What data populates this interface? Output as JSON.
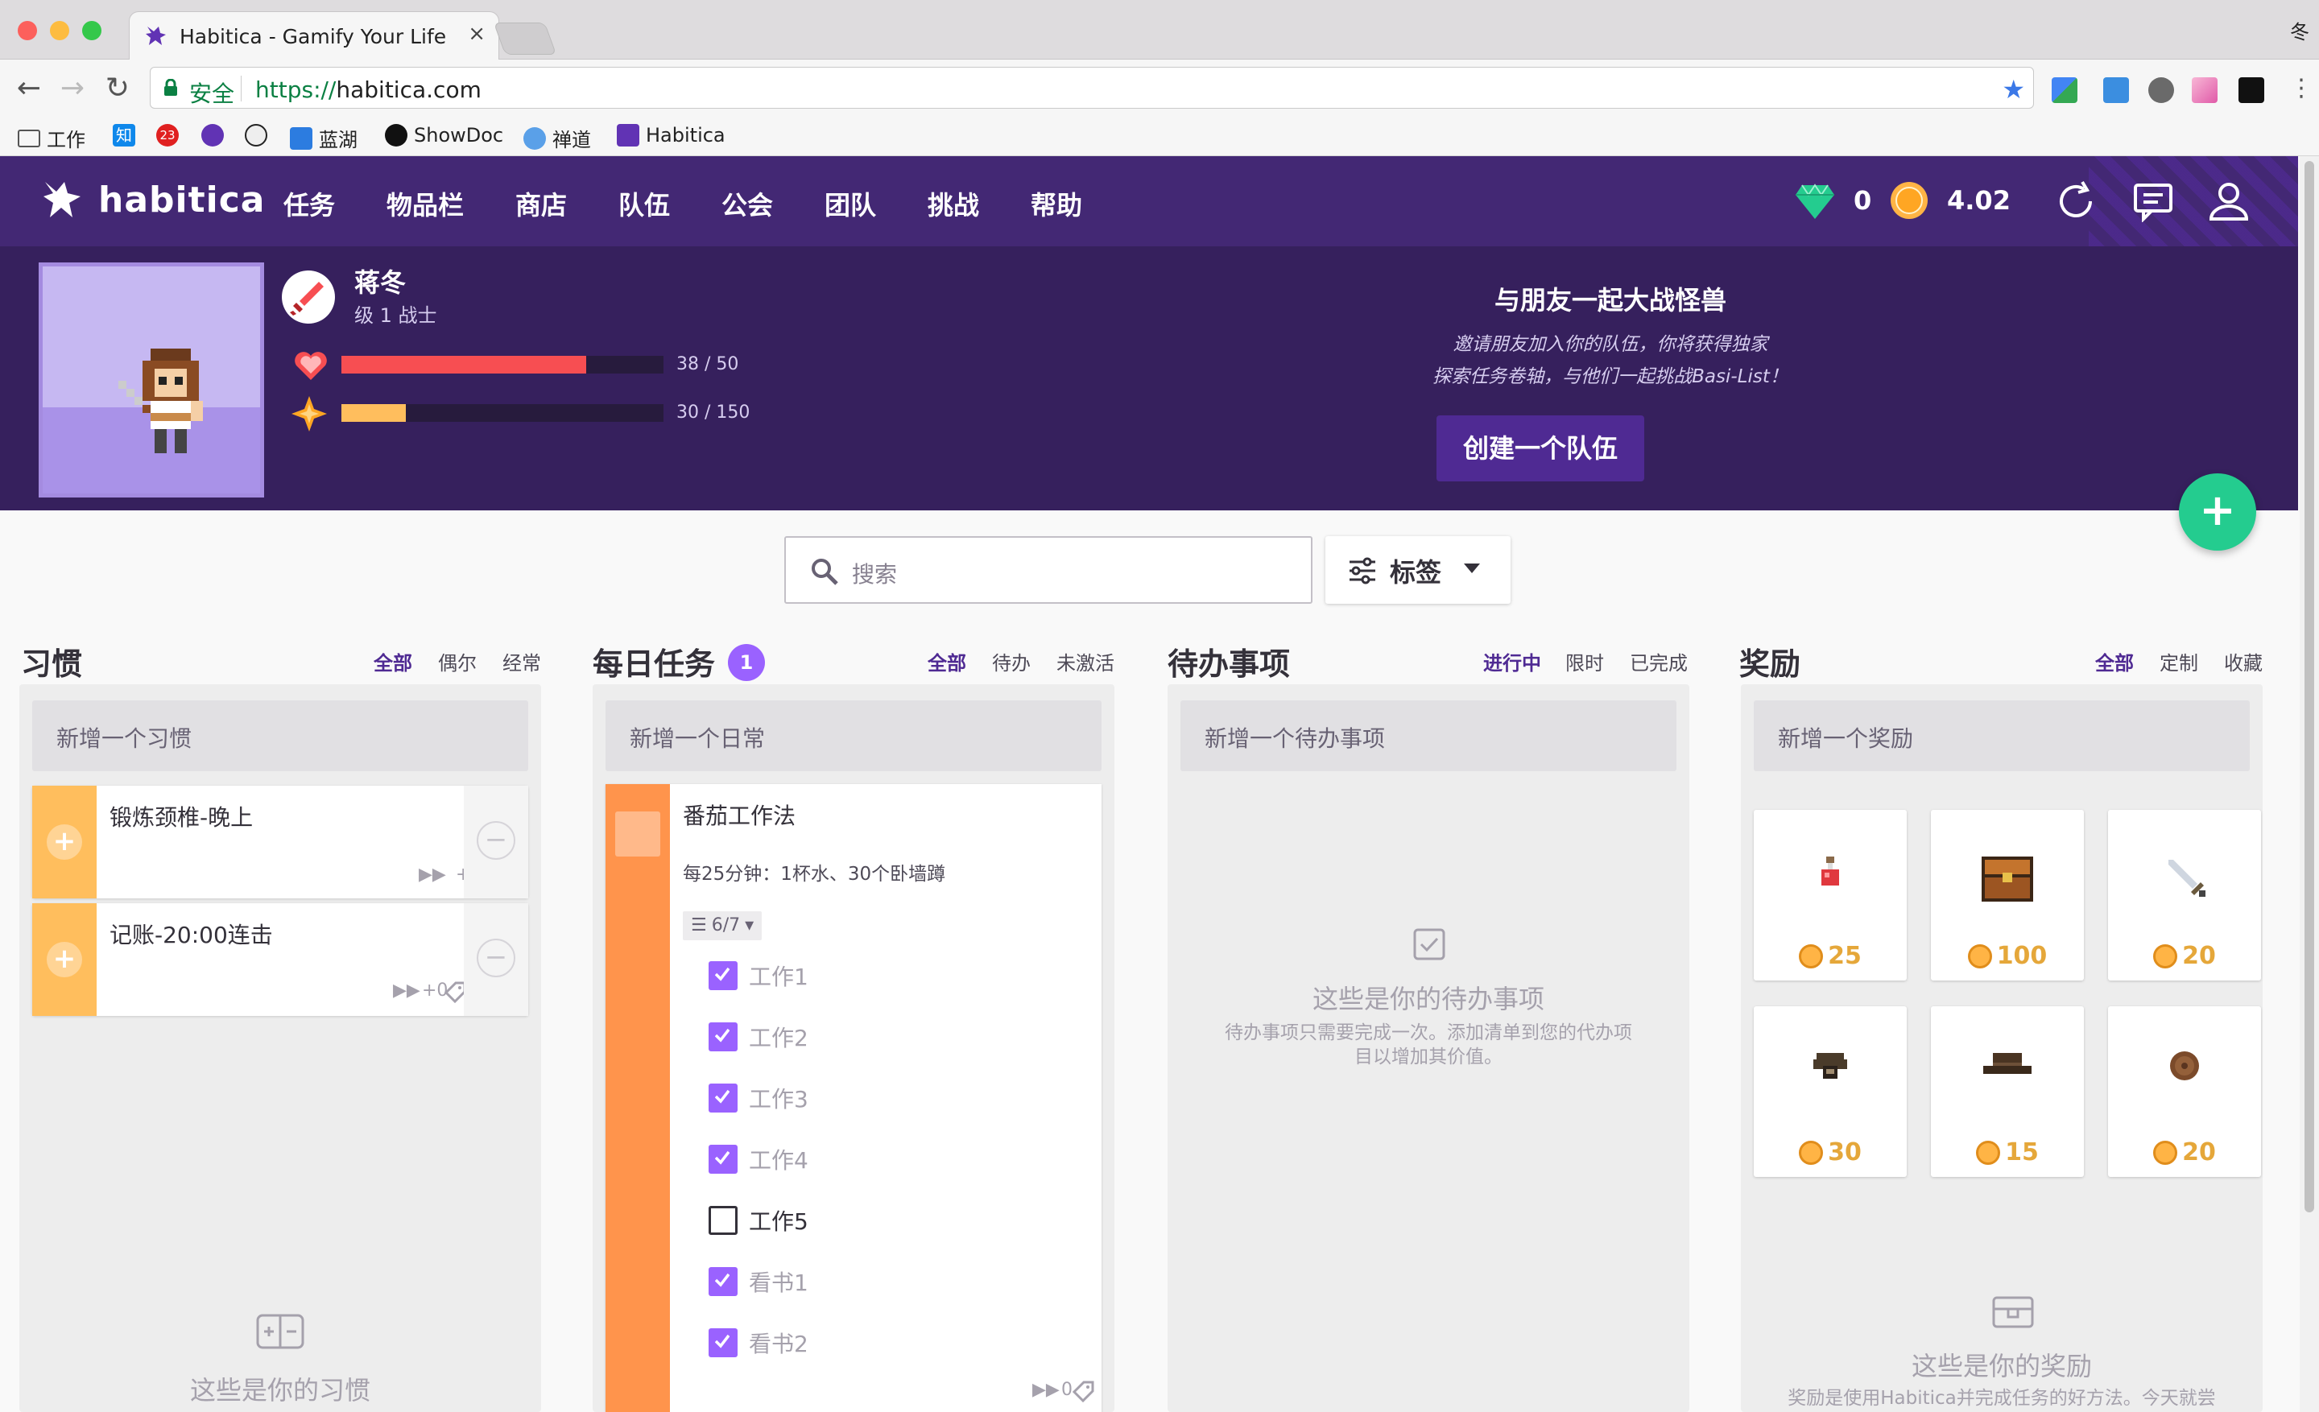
{
  "browser": {
    "tab_title": "Habitica - Gamify Your Life",
    "tab_close": "×",
    "user_label": "冬",
    "secure_label": "安全",
    "url_proto": "https://",
    "url_host": "habitica.com",
    "bookmarks": [
      "工作",
      "知",
      "23",
      "蓝湖",
      "ShowDoc",
      "禅道",
      "Habitica"
    ]
  },
  "nav": {
    "logo": "habitica",
    "items": [
      "任务",
      "物品栏",
      "商店",
      "队伍",
      "公会",
      "团队",
      "挑战",
      "帮助"
    ],
    "gems": "0",
    "gold": "4.02"
  },
  "hero": {
    "name": "蒋冬",
    "level": "级 1 战士",
    "hp_text": "38 / 50",
    "hp_fraction": 0.76,
    "xp_text": "30 / 150",
    "xp_fraction": 0.2,
    "party_title": "与朋友一起大战怪兽",
    "party_desc_1": "邀请朋友加入你的队伍，你将获得独家",
    "party_desc_2": "探索任务卷轴，与他们一起挑战Basi-List！",
    "party_button": "创建一个队伍"
  },
  "toolbar": {
    "search_placeholder": "搜索",
    "tags_label": "标签",
    "fab": "+"
  },
  "habits": {
    "title": "习惯",
    "filters": [
      "全部",
      "偶尔",
      "经常"
    ],
    "add_label": "新增一个习惯",
    "items": [
      {
        "title": "锻炼颈椎-晚上",
        "score": "+0"
      },
      {
        "title": "记账-20:00连击",
        "score": "+0"
      }
    ],
    "plus": "+",
    "minus": "−",
    "empty_title": "这些是你的习惯"
  },
  "dailies": {
    "title": "每日任务",
    "badge": "1",
    "filters": [
      "全部",
      "待办",
      "未激活"
    ],
    "add_label": "新增一个日常",
    "task_title": "番茄工作法",
    "task_notes": "每25分钟：1杯水、30个卧墙蹲",
    "checklist_count": "6/7",
    "checklist": [
      {
        "text": "工作1",
        "done": true
      },
      {
        "text": "工作2",
        "done": true
      },
      {
        "text": "工作3",
        "done": true
      },
      {
        "text": "工作4",
        "done": true
      },
      {
        "text": "工作5",
        "done": false
      },
      {
        "text": "看书1",
        "done": true
      },
      {
        "text": "看书2",
        "done": true
      }
    ],
    "streak": "0"
  },
  "todos": {
    "title": "待办事项",
    "filters": [
      "进行中",
      "限时",
      "已完成"
    ],
    "add_label": "新增一个待办事项",
    "empty_title": "这些是你的待办事项",
    "empty_desc_1": "待办事项只需要完成一次。添加清单到您的代办项",
    "empty_desc_2": "目以增加其价值。"
  },
  "rewards": {
    "title": "奖励",
    "filters": [
      "全部",
      "定制",
      "收藏"
    ],
    "add_label": "新增一个奖励",
    "items": [
      {
        "icon": "potion-icon",
        "price": "25"
      },
      {
        "icon": "armoire-icon",
        "price": "100"
      },
      {
        "icon": "sword-icon",
        "price": "20"
      },
      {
        "icon": "helm-icon",
        "price": "30"
      },
      {
        "icon": "hat-icon",
        "price": "15"
      },
      {
        "icon": "shield-icon",
        "price": "20"
      }
    ],
    "empty_title": "这些是你的奖励",
    "empty_desc": "奖励是使用Habitica并完成任务的好方法。今天就尝"
  },
  "colors": {
    "brand": "#432874",
    "hero_bg": "#36205d",
    "accent": "#9a62ff",
    "hp": "#f74e52",
    "xp": "#ffbe5d",
    "habit": "#ffbe5d",
    "daily": "#ff944c",
    "fab": "#24cc8f"
  }
}
